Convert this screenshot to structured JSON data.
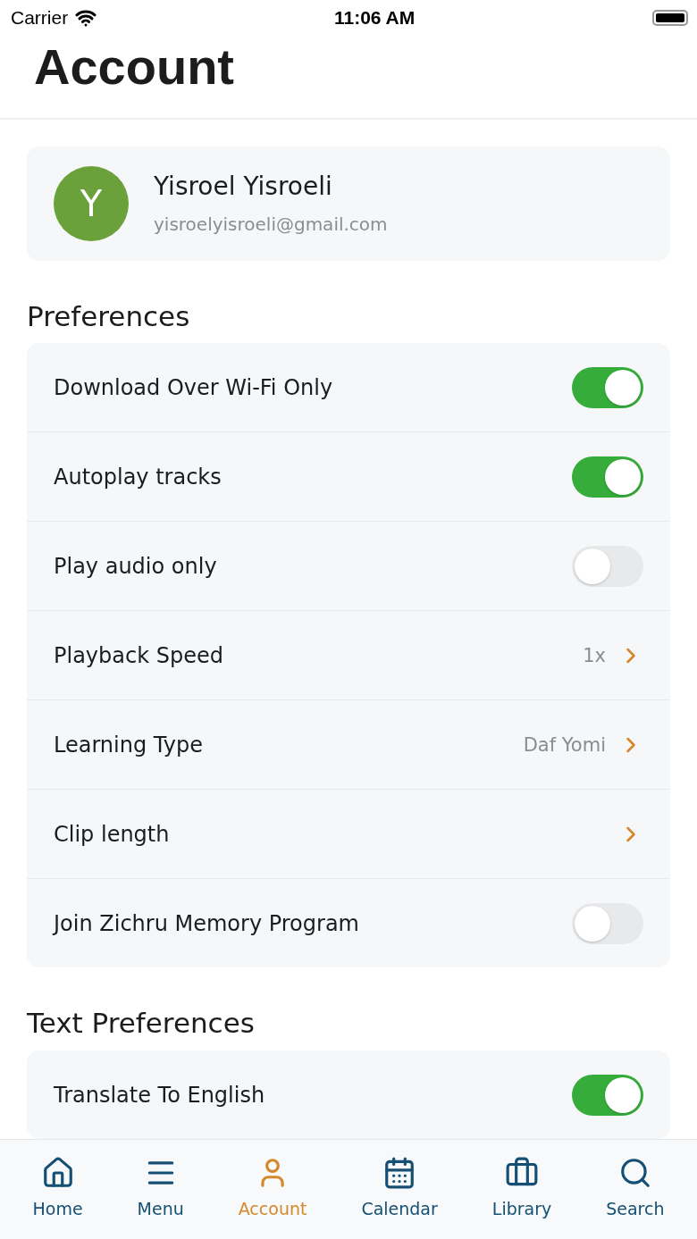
{
  "status_bar": {
    "carrier": "Carrier",
    "time": "11:06 AM"
  },
  "title": "Account",
  "profile": {
    "initial": "Y",
    "name": "Yisroel Yisroeli",
    "email": "yisroelyisroeli@gmail.com"
  },
  "sections": [
    {
      "title": "Preferences",
      "rows": [
        {
          "kind": "toggle",
          "label": "Download Over Wi-Fi Only",
          "on": true
        },
        {
          "kind": "toggle",
          "label": "Autoplay tracks",
          "on": true
        },
        {
          "kind": "toggle",
          "label": "Play audio only",
          "on": false
        },
        {
          "kind": "link",
          "label": "Playback Speed",
          "value": "1x"
        },
        {
          "kind": "link",
          "label": "Learning Type",
          "value": "Daf Yomi"
        },
        {
          "kind": "link",
          "label": "Clip length"
        },
        {
          "kind": "toggle",
          "label": "Join Zichru Memory Program",
          "on": false
        }
      ]
    },
    {
      "title": "Text Preferences",
      "rows": [
        {
          "kind": "toggle",
          "label": "Translate To English",
          "on": true
        }
      ]
    }
  ],
  "tabs": [
    {
      "label": "Home",
      "selected": false
    },
    {
      "label": "Menu",
      "selected": false
    },
    {
      "label": "Account",
      "selected": true
    },
    {
      "label": "Calendar",
      "selected": false
    },
    {
      "label": "Library",
      "selected": false
    },
    {
      "label": "Search",
      "selected": false
    }
  ]
}
